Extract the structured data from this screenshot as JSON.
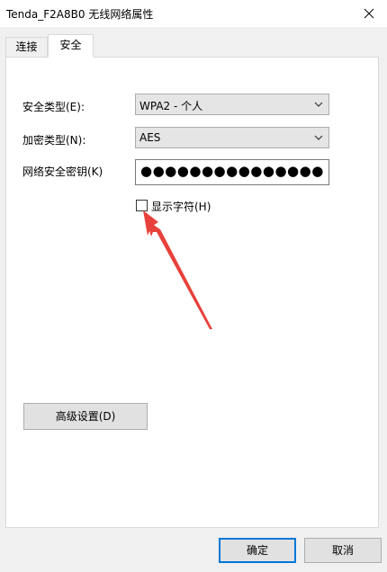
{
  "window": {
    "title": "Tenda_F2A8B0 无线网络属性",
    "close_icon": "close-icon"
  },
  "tabs": [
    {
      "label": "连接",
      "active": false
    },
    {
      "label": "安全",
      "active": true
    }
  ],
  "security": {
    "type_label": "安全类型(E):",
    "type_value": "WPA2 - 个人",
    "encryption_label": "加密类型(N):",
    "encryption_value": "AES",
    "key_label": "网络安全密钥(K)",
    "key_masked": "●●●●●●●●●●●●●●●",
    "show_chars_label": "显示字符(H)",
    "show_chars_checked": false
  },
  "buttons": {
    "advanced": "高级设置(D)",
    "ok": "确定",
    "cancel": "取消"
  },
  "colors": {
    "annotation_arrow": "#e8403a",
    "default_button_border": "#0078d7"
  }
}
